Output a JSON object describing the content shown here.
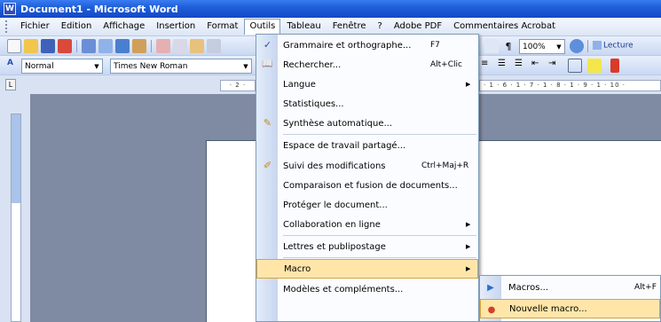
{
  "window": {
    "title": "Document1 - Microsoft Word",
    "app_icon": "W"
  },
  "menubar": {
    "items": [
      "Fichier",
      "Edition",
      "Affichage",
      "Insertion",
      "Format",
      "Outils",
      "Tableau",
      "Fenêtre",
      "?",
      "Adobe PDF",
      "Commentaires Acrobat"
    ],
    "active": "Outils"
  },
  "toolbar": {
    "zoom": "100%",
    "reading": "Lecture",
    "style": "Normal",
    "font": "Times New Roman"
  },
  "ruler": {
    "left_marker": "· 2 ·",
    "marks": "· 1 · 6 · 1 · 7 · 1 · 8 · 1 · 9 · 1 · 10 ·",
    "tab_glyph": "L"
  },
  "tools_menu": {
    "items": [
      {
        "label": "Grammaire et orthographe...",
        "shortcut": "F7",
        "icon": "spelling-icon",
        "glyph": "✓"
      },
      {
        "label": "Rechercher...",
        "shortcut": "Alt+Clic",
        "icon": "research-icon",
        "glyph": "📖"
      },
      {
        "label": "Langue",
        "submenu": true
      },
      {
        "label": "Statistiques..."
      },
      {
        "label": "Synthèse automatique...",
        "icon": "autosummarize-icon",
        "glyph": "✎"
      },
      {
        "label": "Espace de travail partagé..."
      },
      {
        "label": "Suivi des modifications",
        "shortcut": "Ctrl+Maj+R",
        "icon": "track-changes-icon",
        "glyph": "✐"
      },
      {
        "label": "Comparaison et fusion de documents..."
      },
      {
        "label": "Protéger le document..."
      },
      {
        "label": "Collaboration en ligne",
        "submenu": true
      },
      {
        "label": "Lettres et publipostage",
        "submenu": true
      },
      {
        "label": "Macro",
        "submenu": true,
        "highlighted": true
      },
      {
        "label": "Modèles et compléments..."
      }
    ]
  },
  "macro_submenu": {
    "items": [
      {
        "label": "Macros...",
        "shortcut": "Alt+F",
        "icon": "play-macro-icon",
        "glyph": "▶"
      },
      {
        "label": "Nouvelle macro...",
        "icon": "record-macro-icon",
        "glyph": "●",
        "highlighted": true
      }
    ]
  },
  "colors": {
    "highlight": "#ffe6a8",
    "title_blue": "#1f5fd8"
  }
}
